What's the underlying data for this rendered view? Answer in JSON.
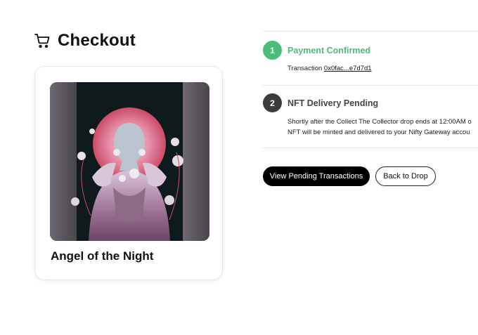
{
  "header": {
    "title": "Checkout",
    "icon": "shopping-cart-icon"
  },
  "nft": {
    "title": "Angel of the Night",
    "image_description": "artwork-figure-in-pink-bubble-helmet"
  },
  "steps": [
    {
      "number": "1",
      "title": "Payment Confirmed",
      "status": "confirmed",
      "detail_prefix": "Transaction ",
      "transaction_link": "0x0fac...e7d7d1"
    },
    {
      "number": "2",
      "title": "NFT Delivery Pending",
      "status": "pending",
      "detail_line1": "Shortly after the Collect The Collector drop ends at 12:00AM o",
      "detail_line2": "NFT will be minted and delivered to your Nifty Gateway accou"
    }
  ],
  "actions": {
    "primary_label": "View Pending Transactions",
    "secondary_label": "Back to Drop"
  },
  "colors": {
    "confirmed": "#4dbb7a",
    "pending": "#3c3c3c",
    "pending_text": "#444444"
  }
}
